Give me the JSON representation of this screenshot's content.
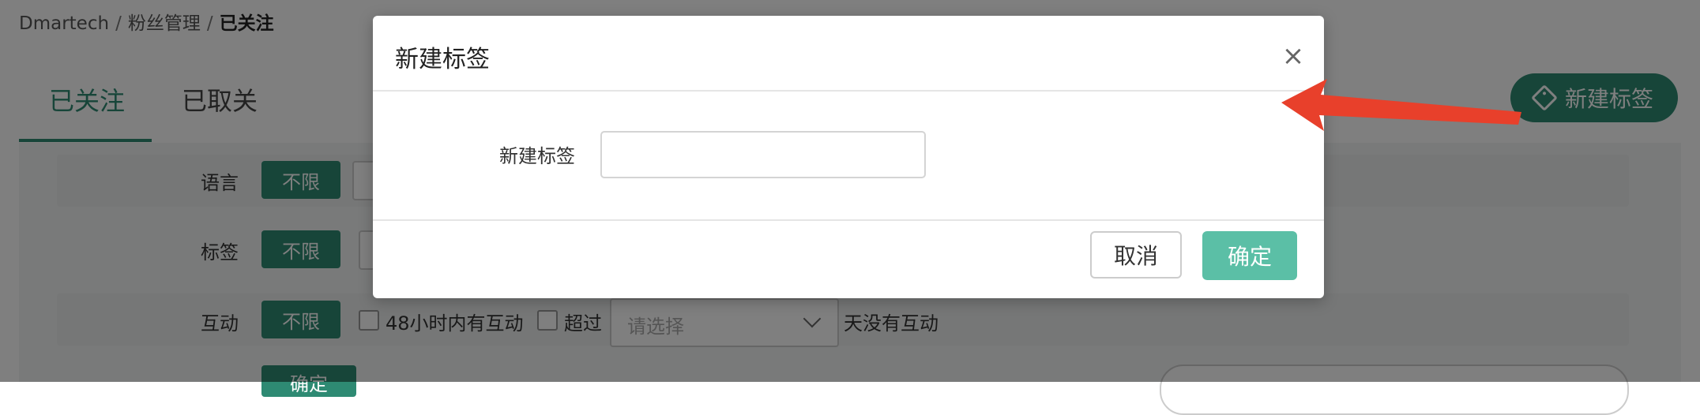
{
  "breadcrumb": {
    "root": "Dmartech",
    "section": "粉丝管理",
    "current": "已关注",
    "sep": "/"
  },
  "tabs": {
    "followed": "已关注",
    "unfollowed": "已取关"
  },
  "toolbar": {
    "new_tag_label": "新建标签"
  },
  "filters": {
    "language_label": "语言",
    "tag_label": "标签",
    "interaction_label": "互动",
    "unlimited": "不限",
    "within_48h": "48小时内有互动",
    "more_than": "超过",
    "select_placeholder": "请选择",
    "no_interaction_suffix": "天没有互动",
    "confirm_label": "确定"
  },
  "modal": {
    "title": "新建标签",
    "close_symbol": "×",
    "field_label": "新建标签",
    "field_value": "",
    "cancel_label": "取消",
    "ok_label": "确定"
  },
  "colors": {
    "accent": "#2e8a73",
    "ok_button": "#5bbfa6",
    "annotation_arrow": "#e8402b"
  }
}
